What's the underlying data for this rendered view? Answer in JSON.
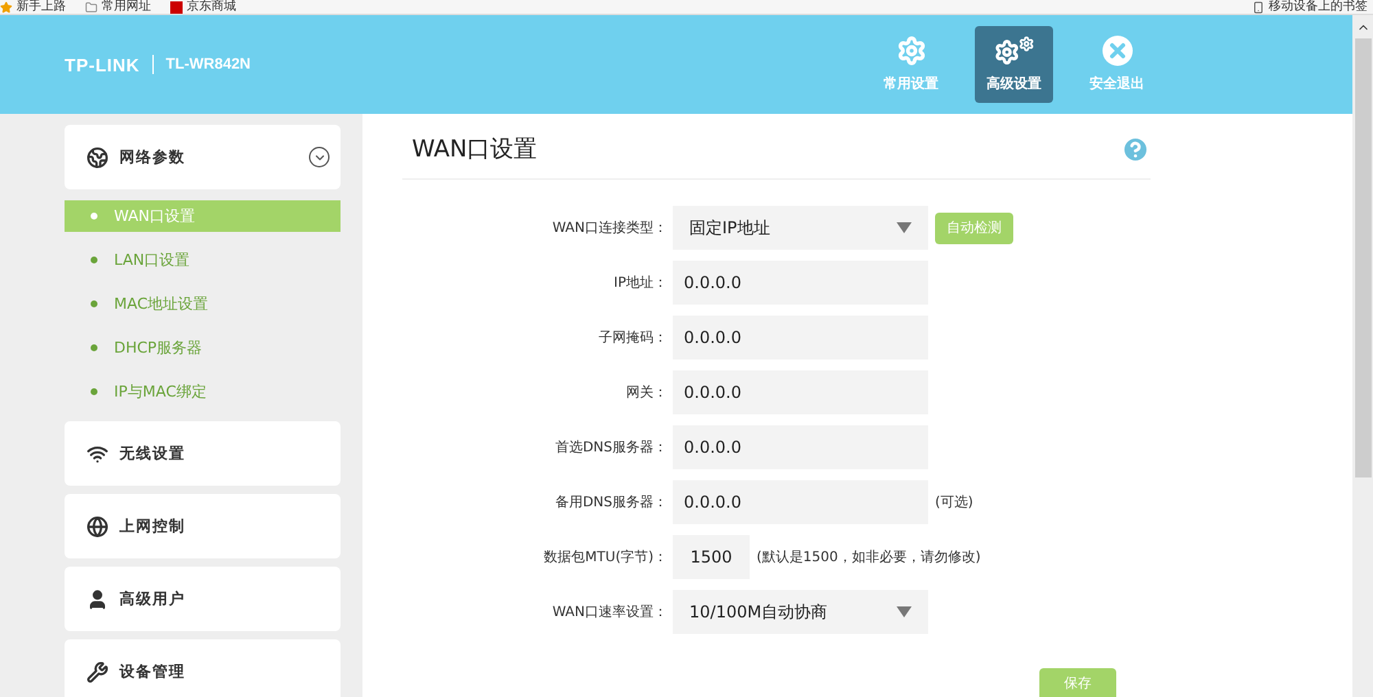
{
  "bookmarks": {
    "left": [
      {
        "label": "新手上路",
        "kind": "star"
      },
      {
        "label": "常用网址",
        "kind": "folder"
      },
      {
        "label": "京东商城",
        "kind": "brand"
      }
    ],
    "right": {
      "label": "移动设备上的书签"
    }
  },
  "header": {
    "brand": "TP-LINK",
    "model": "TL-WR842N",
    "nav": [
      {
        "label": "常用设置",
        "kind": "gear",
        "selected": false
      },
      {
        "label": "高级设置",
        "kind": "gears",
        "selected": true
      },
      {
        "label": "安全退出",
        "kind": "exit",
        "selected": false
      }
    ]
  },
  "sidebar": {
    "groups": [
      {
        "label": "网络参数",
        "kind": "network",
        "expanded": true,
        "children": [
          {
            "label": "WAN口设置",
            "selected": true
          },
          {
            "label": "LAN口设置",
            "selected": false
          },
          {
            "label": "MAC地址设置",
            "selected": false
          },
          {
            "label": "DHCP服务器",
            "selected": false
          },
          {
            "label": "IP与MAC绑定",
            "selected": false
          }
        ]
      },
      {
        "label": "无线设置",
        "kind": "wifi",
        "expanded": false
      },
      {
        "label": "上网控制",
        "kind": "internet",
        "expanded": false
      },
      {
        "label": "高级用户",
        "kind": "user",
        "expanded": false
      },
      {
        "label": "设备管理",
        "kind": "tools",
        "expanded": false
      }
    ]
  },
  "page": {
    "title": "WAN口设置",
    "rows": [
      {
        "label": "WAN口连接类型：",
        "kind": "select",
        "value": "固定IP地址",
        "button": "自动检测"
      },
      {
        "label": "IP地址：",
        "kind": "input",
        "value": "0.0.0.0"
      },
      {
        "label": "子网掩码：",
        "kind": "input",
        "value": "0.0.0.0"
      },
      {
        "label": "网关：",
        "kind": "input",
        "value": "0.0.0.0"
      },
      {
        "label": "首选DNS服务器：",
        "kind": "input",
        "value": "0.0.0.0"
      },
      {
        "label": "备用DNS服务器：",
        "kind": "input",
        "value": "0.0.0.0",
        "note": "(可选)"
      },
      {
        "label": "数据包MTU(字节)：",
        "kind": "short",
        "value": "1500",
        "note": "(默认是1500，如非必要，请勿修改)"
      },
      {
        "label": "WAN口速率设置：",
        "kind": "select",
        "value": "10/100M自动协商"
      }
    ],
    "save": "保存"
  }
}
